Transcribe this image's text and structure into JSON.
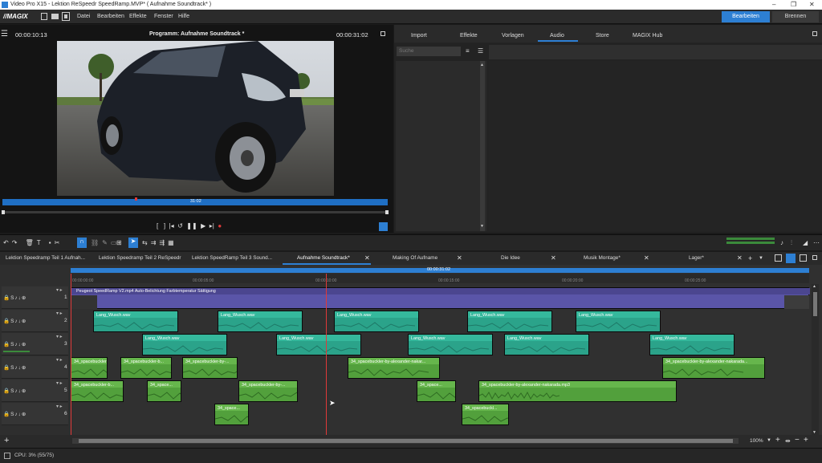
{
  "titlebar": {
    "title": "Video Pro X15 - Lektion ReSpeedr SpeedRamp.MVP* ( Aufnahme Soundtrack* )",
    "minimize": "–",
    "maximize": "❐",
    "close": "✕"
  },
  "menubar": {
    "logo": "MAGIX",
    "items": [
      "Datei",
      "Bearbeiten",
      "Effekte",
      "Fenster",
      "Hilfe"
    ],
    "mode_edit": "Bearbeiten",
    "mode_burn": "Brennen"
  },
  "preview": {
    "timecode_left": "00:00:10:13",
    "title": "Programm: Aufnahme Soundtrack *",
    "timecode_right": "00:00:31:02",
    "scrub_time": "31:02"
  },
  "media": {
    "tabs": [
      "Import",
      "Effekte",
      "Vorlagen",
      "Audio",
      "Store",
      "MAGIX Hub"
    ],
    "active_tab": "Audio",
    "search_placeholder": "Suche"
  },
  "project_tabs": [
    "Lektion Speedramp Teil 1 Aufnah...",
    "Lektion Speedramp Teil 2 ReSpeedr",
    "Lektion SpeedRamp Teil 3 Sound...",
    "Aufnahme Soundtrack*",
    "Making Of Aufname",
    "Die Idee",
    "Musik Montage*",
    "Lager*"
  ],
  "timeline": {
    "ruler_total": "00:00:31:02",
    "ruler_ticks": [
      "00:00:00:00",
      "00:00:05:00",
      "00:00:10:00",
      "00:00:15:00",
      "00:00:20:00",
      "00:00:25:00"
    ],
    "track_numbers": [
      "1",
      "2",
      "3",
      "4",
      "5",
      "6"
    ],
    "video_clip_label": "Peugeot SpeedRamp V2.mp4   Auto-Belichtung   Farbtemperatur   Sättigung",
    "clip_lang": "Lang_Wusch.wav",
    "clip_space_short": "34_spacebuckler-b...",
    "clip_space_med": "34_spacebuckler-by-...",
    "clip_space_long": "34_spacebuckler-by-alexander-nakar...",
    "clip_space_full": "34_spacebuckler-by-alexander-nakarada...",
    "clip_space_mp3": "34_spacebuckler-by-alexander-nakarada.mp3",
    "clip_space_tiny": "34_space...",
    "clip_space_b": "34_spacebuckl...",
    "zoom": "100%"
  },
  "status": {
    "cpu": "CPU:  3% (55/75)"
  },
  "colors": {
    "accent": "#2d7fd3",
    "teal": "#2ba38a",
    "green": "#52a03c",
    "video": "#5a55a8",
    "playhead": "#e03a3a"
  }
}
